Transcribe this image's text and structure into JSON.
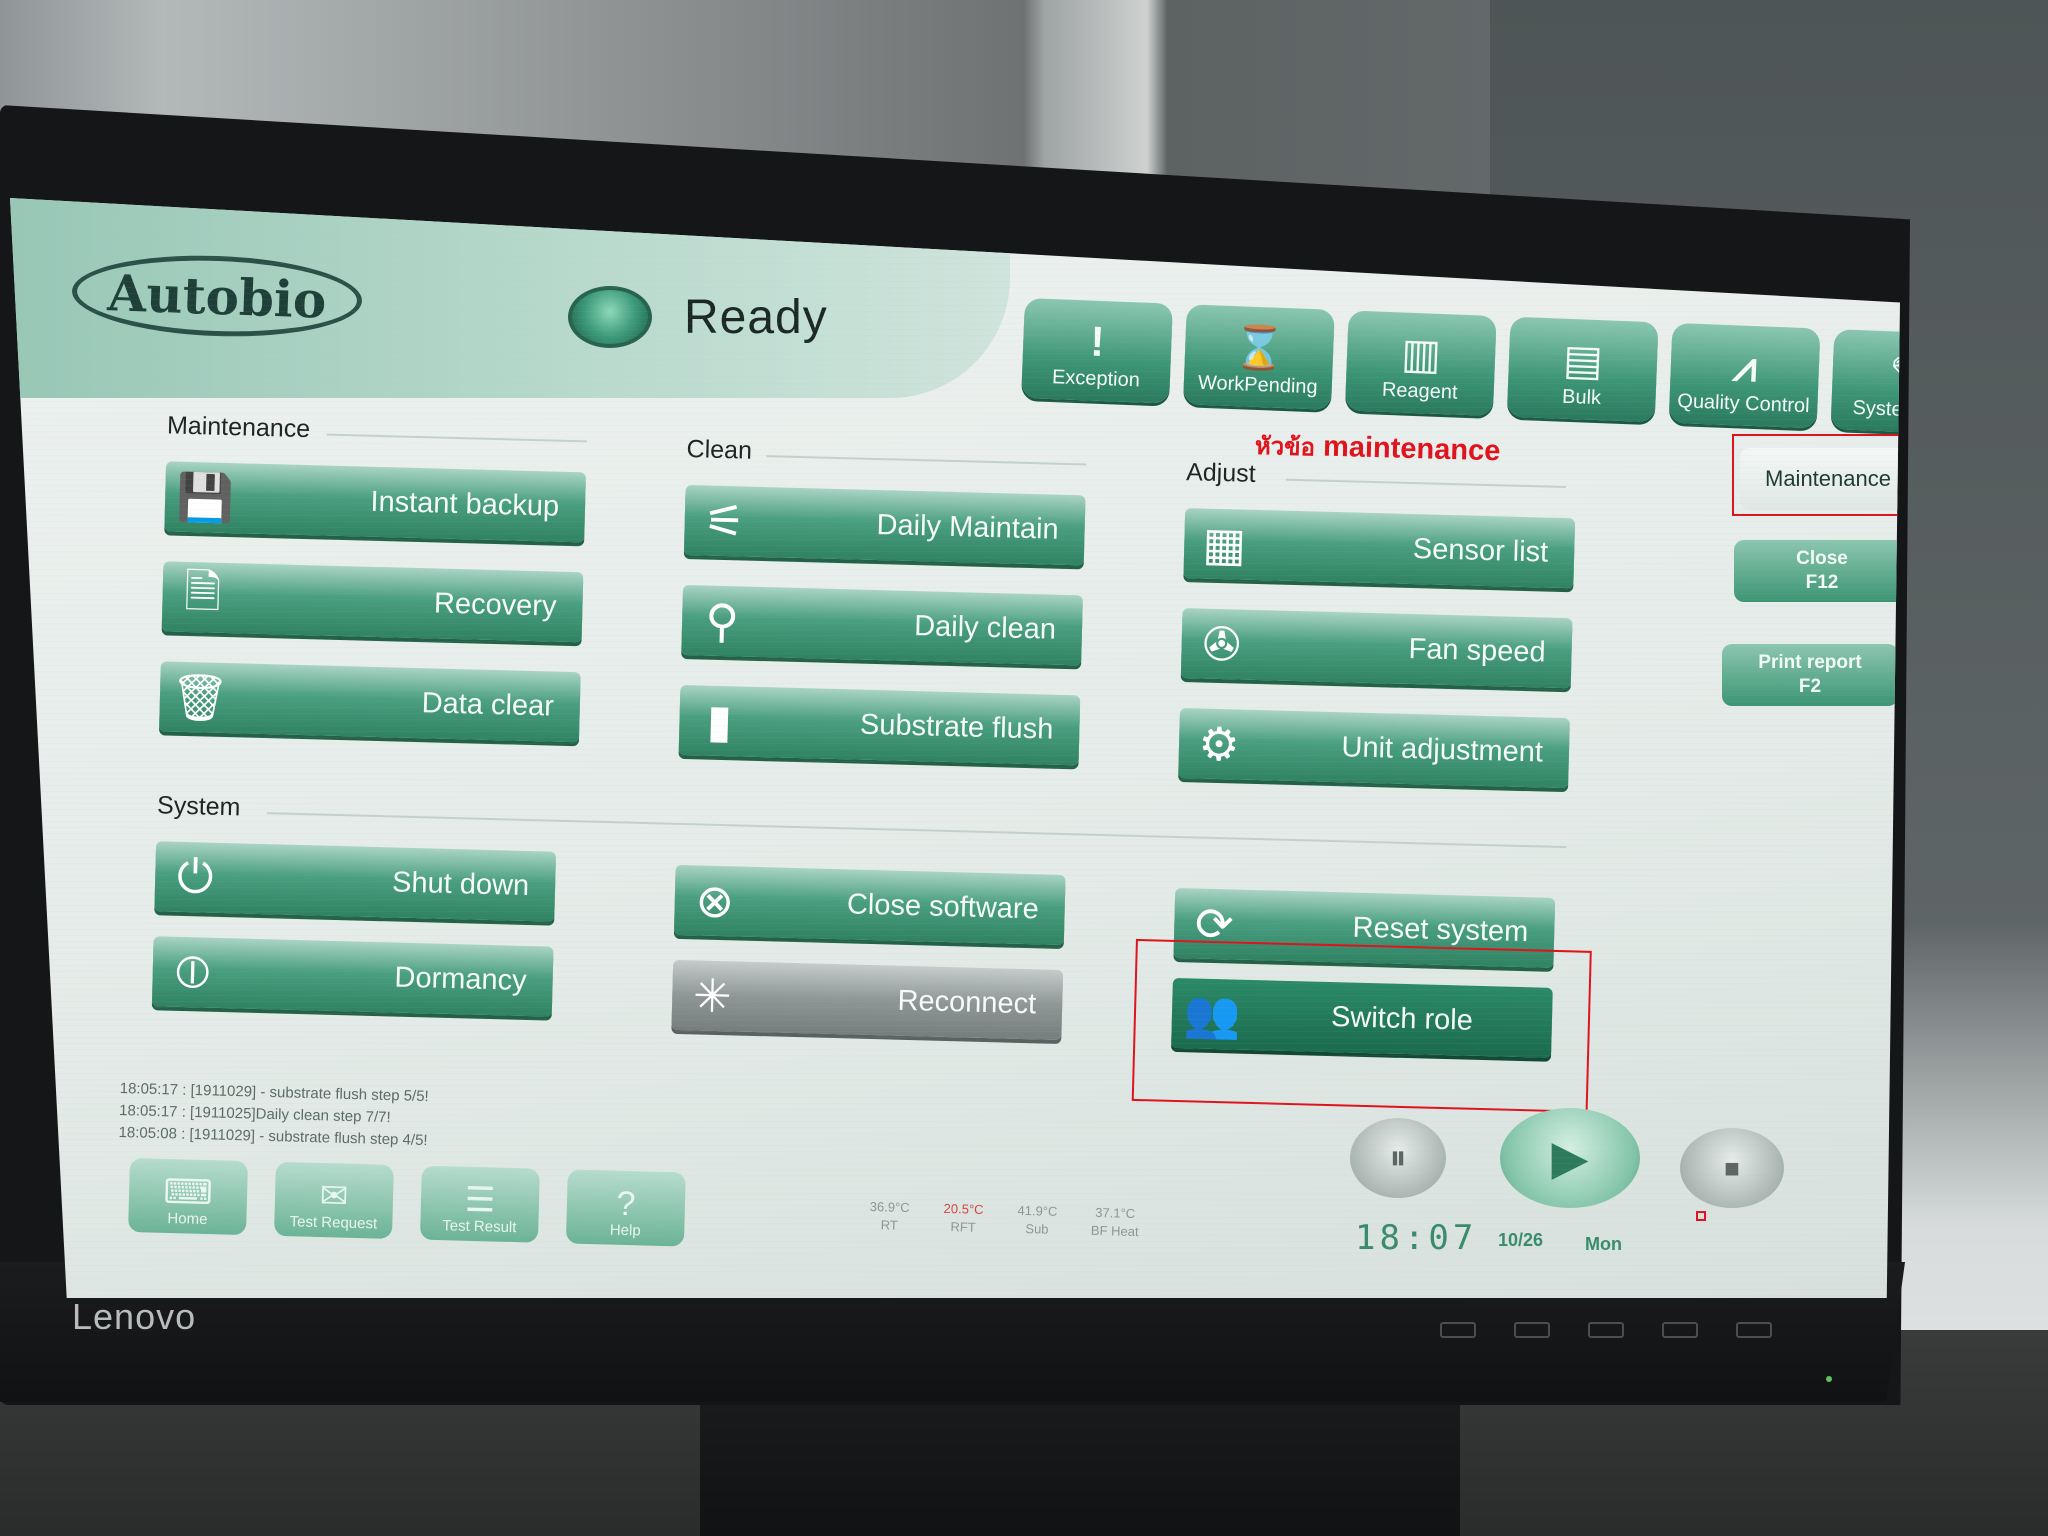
{
  "monitor": {
    "brand": "Lenovo"
  },
  "app": {
    "logo": "Autobio",
    "status": "Ready"
  },
  "toolbar": [
    {
      "label": "Exception",
      "icon": "exclamation-icon",
      "glyph": "!"
    },
    {
      "label": "WorkPending",
      "icon": "hourglass-icon",
      "glyph": "⌛"
    },
    {
      "label": "Reagent",
      "icon": "reagent-rack-icon",
      "glyph": "▥"
    },
    {
      "label": "Bulk",
      "icon": "bulk-bottles-icon",
      "glyph": "▤"
    },
    {
      "label": "Quality Control",
      "icon": "qc-chart-icon",
      "glyph": "⩘"
    },
    {
      "label": "System Log",
      "icon": "log-pen-icon",
      "glyph": "✎"
    }
  ],
  "side_panel": {
    "maintenance": "Maintenance",
    "close": "Close",
    "close_key": "F12",
    "print_report": "Print report",
    "print_report_key": "F2"
  },
  "groups": {
    "maintenance": "Maintenance",
    "clean": "Clean",
    "adjust": "Adjust",
    "system": "System"
  },
  "buttons": {
    "instant_backup": "Instant backup",
    "recovery": "Recovery",
    "data_clear": "Data clear",
    "daily_maintain": "Daily Maintain",
    "daily_clean": "Daily clean",
    "substrate_flush": "Substrate flush",
    "sensor_list": "Sensor list",
    "fan_speed": "Fan speed",
    "unit_adjustment": "Unit adjustment",
    "shut_down": "Shut down",
    "dormancy": "Dormancy",
    "close_software": "Close software",
    "reconnect": "Reconnect",
    "reset_system": "Reset system",
    "switch_role": "Switch role"
  },
  "annotation": {
    "thai_prefix": "หัวข้อ",
    "word": "maintenance",
    "color": "#e0121c"
  },
  "log": [
    "18:05:17 : [1911029] - substrate flush step 5/5!",
    "18:05:17 : [1911025]Daily clean step 7/7!",
    "18:05:08 : [1911029] - substrate flush step 4/5!"
  ],
  "bottom_nav": [
    {
      "label": "Home",
      "icon": "home-keyboard-icon",
      "glyph": "⌨"
    },
    {
      "label": "Test Request",
      "icon": "test-request-icon",
      "glyph": "✉"
    },
    {
      "label": "Test Result",
      "icon": "test-result-icon",
      "glyph": "☰"
    },
    {
      "label": "Help",
      "icon": "help-icon",
      "glyph": "?"
    }
  ],
  "temperatures": [
    {
      "value": "36.9°C",
      "label": "RT",
      "warn": false
    },
    {
      "value": "20.5°C",
      "label": "RFT",
      "warn": true
    },
    {
      "value": "41.9°C",
      "label": "Sub",
      "warn": false
    },
    {
      "value": "37.1°C",
      "label": "BF Heat",
      "warn": false
    }
  ],
  "clock": {
    "time": "18:07",
    "date": "10/26",
    "weekday": "Mon"
  },
  "colors": {
    "accent": "#3e9677",
    "accent_dark": "#1b6b4e",
    "screen_bg": "#e4ebe8"
  }
}
